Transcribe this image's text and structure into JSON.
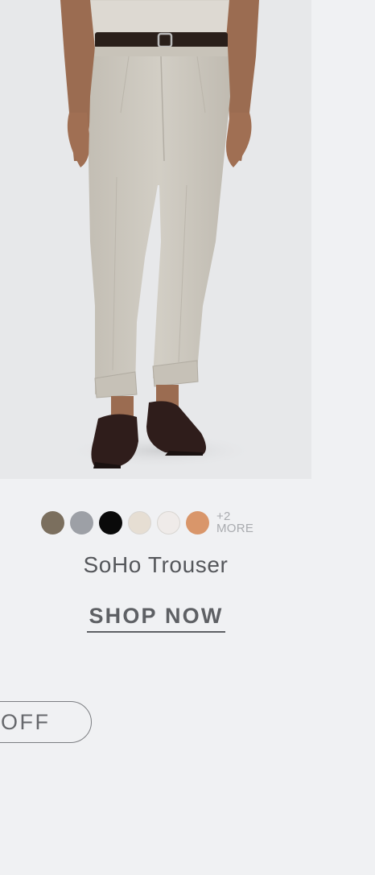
{
  "product": {
    "name": "SoHo Trouser",
    "image_alt": "Model wearing stone-colored pleated trousers with brown loafers",
    "swatches": [
      {
        "color_name": "olive-brown",
        "hex": "#7b6f5e"
      },
      {
        "color_name": "grey",
        "hex": "#9da0a6"
      },
      {
        "color_name": "black",
        "hex": "#0a0a0a"
      },
      {
        "color_name": "stone",
        "hex": "#e6ded3"
      },
      {
        "color_name": "off-white",
        "hex": "#efebe9"
      },
      {
        "color_name": "tan",
        "hex": "#d9966a"
      }
    ],
    "more_count": "+2",
    "more_label": "MORE",
    "cta_label": "SHOP NOW"
  },
  "promo": {
    "pill_label": "OFF"
  },
  "colors": {
    "background": "#f0f1f3",
    "text": "#55575b",
    "muted": "#a9abaf"
  }
}
